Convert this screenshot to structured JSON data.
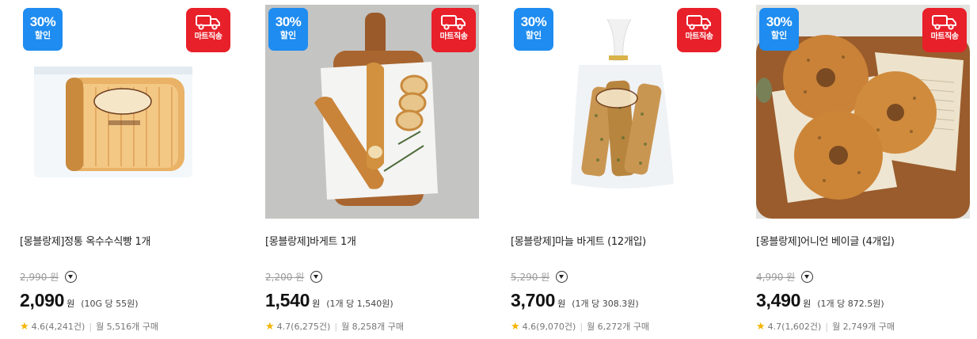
{
  "products": [
    {
      "sale_badge": "30%",
      "sale_label": "할인",
      "delivery_label": "마트직송",
      "name": "[몽블랑제]정통 옥수수식빵 1개",
      "original_price": "2,990 원",
      "price": "2,090",
      "currency": "원",
      "unit_price": "(10G 당 55원)",
      "rating": "4.6(4,241건)",
      "monthly_sales": "월 5,516개 구매",
      "image": "corn-bread-loaf"
    },
    {
      "sale_badge": "30%",
      "sale_label": "할인",
      "delivery_label": "마트직송",
      "name": "[몽블랑제]바게트 1개",
      "original_price": "2,200 원",
      "price": "1,540",
      "currency": "원",
      "unit_price": "(1개 당 1,540원)",
      "rating": "4.7(6,275건)",
      "monthly_sales": "월 8,258개 구매",
      "image": "baguette-on-board"
    },
    {
      "sale_badge": "30%",
      "sale_label": "할인",
      "delivery_label": "마트직송",
      "name": "[몽블랑제]마늘 바게트 (12개입)",
      "original_price": "5,290 원",
      "price": "3,700",
      "currency": "원",
      "unit_price": "(1개 당 308.3원)",
      "rating": "4.6(9,070건)",
      "monthly_sales": "월 6,272개 구매",
      "image": "garlic-baguette-bag"
    },
    {
      "sale_badge": "30%",
      "sale_label": "할인",
      "delivery_label": "마트직송",
      "name": "[몽블랑제]어니언 베이글 (4개입)",
      "original_price": "4,990 원",
      "price": "3,490",
      "currency": "원",
      "unit_price": "(1개 당 872.5원)",
      "rating": "4.7(1,602건)",
      "monthly_sales": "월 2,749개 구매",
      "image": "onion-bagels"
    }
  ]
}
